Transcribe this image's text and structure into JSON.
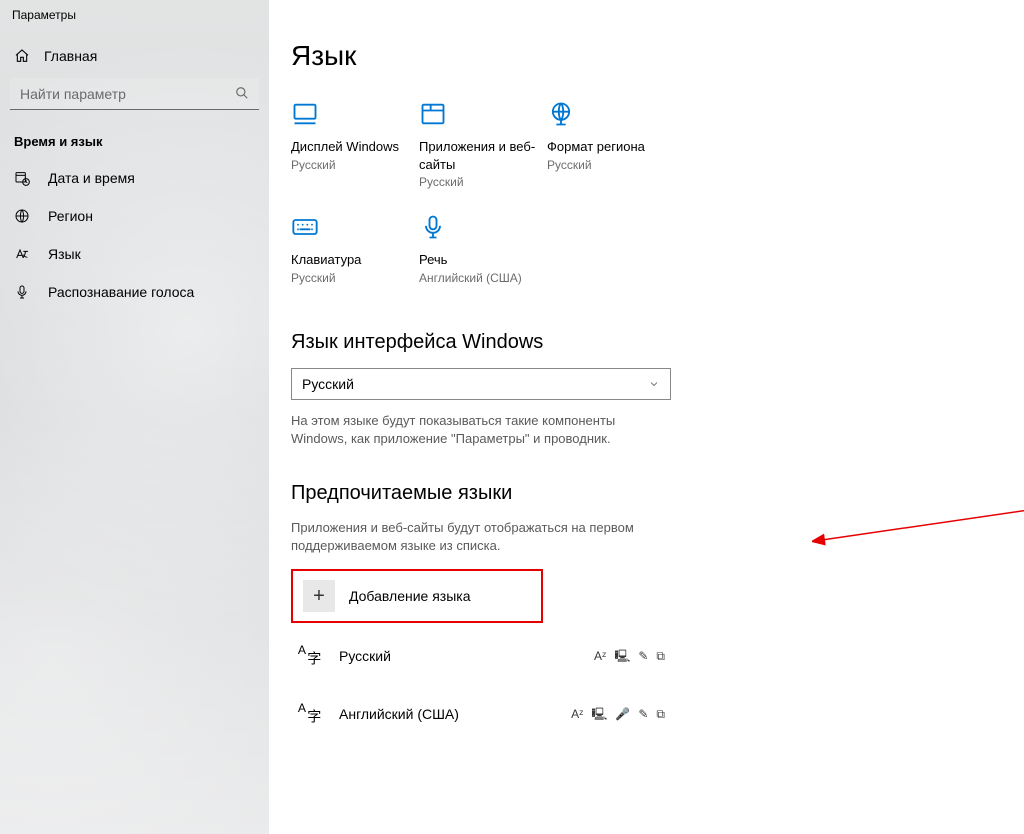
{
  "app_title": "Параметры",
  "home_label": "Главная",
  "search_placeholder": "Найти параметр",
  "nav_group": "Время и язык",
  "nav": {
    "datetime": "Дата и время",
    "region": "Регион",
    "language": "Язык",
    "speech": "Распознавание голоса"
  },
  "page_title": "Язык",
  "tiles": {
    "display": {
      "title": "Дисплей Windows",
      "sub": "Русский"
    },
    "apps": {
      "title": "Приложения и веб-сайты",
      "sub": "Русский"
    },
    "region": {
      "title": "Формат региона",
      "sub": "Русский"
    },
    "keyboard": {
      "title": "Клавиатура",
      "sub": "Русский"
    },
    "speech": {
      "title": "Речь",
      "sub": "Английский (США)"
    }
  },
  "display_lang_h": "Язык интерфейса Windows",
  "display_lang_value": "Русский",
  "display_lang_help": "На этом языке будут показываться такие компоненты Windows, как приложение \"Параметры\" и проводник.",
  "pref_h": "Предпочитаемые языки",
  "pref_desc": "Приложения и веб-сайты будут отображаться на первом поддерживаемом языке из списка.",
  "add_lang_label": "Добавление языка",
  "langs": {
    "ru": "Русский",
    "en": "Английский (США)"
  },
  "colors": {
    "accent": "#0078d4",
    "annotation": "#e60000"
  }
}
